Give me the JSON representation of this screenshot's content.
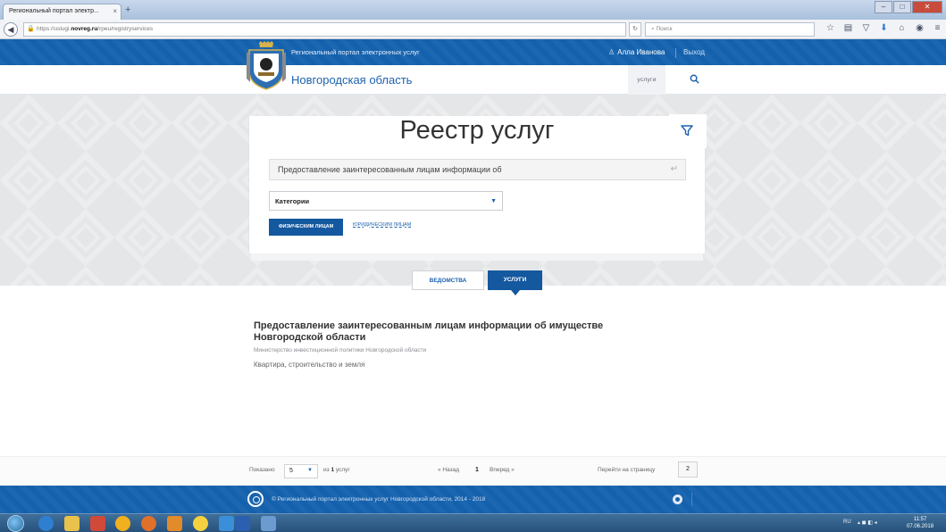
{
  "browser": {
    "tab_title": "Региональный портал электр...",
    "tab_close": "×",
    "new_tab": "+",
    "url_prefix": "https://uslugi.",
    "url_domain": "novreg.ru",
    "url_path": "/rpeu/registryservices",
    "search_placeholder": "Поиск"
  },
  "header": {
    "portal_title": "Региональный портал электронных услуг",
    "user_name": "Алла Иванова",
    "logout": "Выход"
  },
  "subheader": {
    "region_name": "Новгородская область",
    "nav_services": "услуги"
  },
  "hero": {
    "page_title": "Реестр услуг",
    "search_value": "Предоставление заинтересованным лицам информации об",
    "category_select": "Категории",
    "btn_individuals": "ФИЗИЧЕСКИМ ЛИЦАМ",
    "btn_legal": "ЮРИДИЧЕСКИМ ЛИЦАМ"
  },
  "tabs": {
    "departments": "ВЕДОМСТВА",
    "services": "УСЛУГИ"
  },
  "result": {
    "title": "Предоставление заинтересованным лицам информации об имуществе Новгородской области",
    "department": "Министерство инвестиционной политики Новгородской области",
    "category": "Квартира, строительство и земля"
  },
  "pagination": {
    "shown_label": "Показано",
    "per_page": "5",
    "of_prefix": "из",
    "total": "1",
    "of_suffix": "услуг",
    "prev": "« Назад",
    "current_page": "1",
    "next": "Вперед »",
    "goto_label": "Перейти на страницу",
    "goto_value": "2"
  },
  "footer": {
    "copyright": "© Региональный портал электронных услуг Новгородской области, 2014 - 2018"
  },
  "taskbar": {
    "lang": "RU",
    "time": "11:57",
    "date": "07.06.2018"
  },
  "colors": {
    "brand_blue": "#1461ad",
    "button_blue": "#14589f",
    "link_blue": "#1d62ad"
  }
}
